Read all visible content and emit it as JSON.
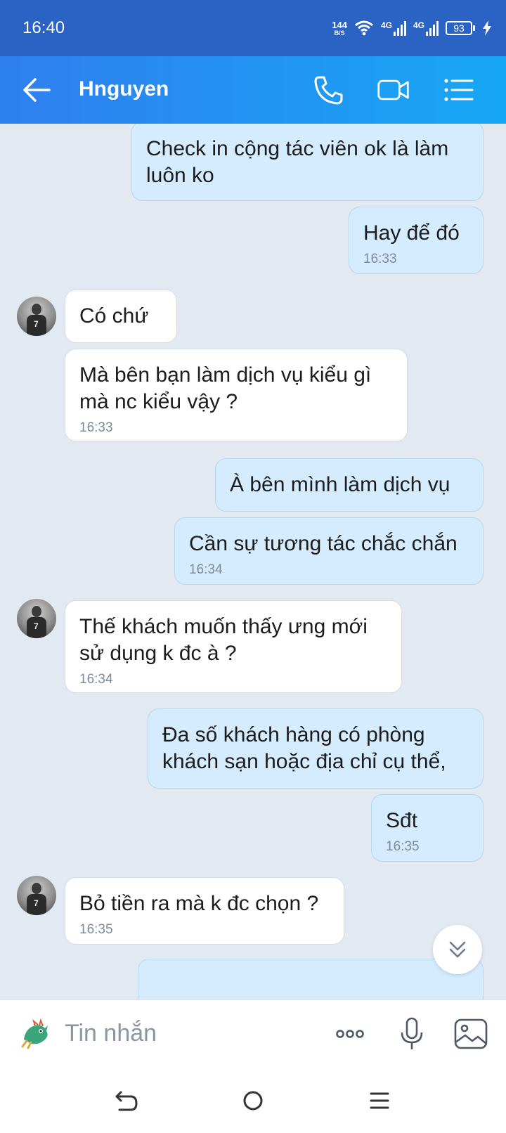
{
  "status_bar": {
    "time": "16:40",
    "net_speed_value": "144",
    "net_speed_unit": "B/S",
    "sim1_label": "4G",
    "sim2_label": "4G",
    "battery": "93"
  },
  "header": {
    "contact_name": "Hnguyen"
  },
  "messages": [
    {
      "sender": "me",
      "text": "Check in cộng tác viên ok là làm luôn ko",
      "time": ""
    },
    {
      "sender": "me",
      "text": "Hay để đó",
      "time": "16:33"
    },
    {
      "sender": "them",
      "text": "Có chứ",
      "time": ""
    },
    {
      "sender": "them",
      "text": "Mà bên bạn làm dịch vụ kiểu gì mà nc kiểu vậy ?",
      "time": "16:33"
    },
    {
      "sender": "me",
      "text": "À bên mình làm dịch vụ",
      "time": ""
    },
    {
      "sender": "me",
      "text": "Cần sự tương tác chắc chắn",
      "time": "16:34"
    },
    {
      "sender": "them",
      "text": "Thế khách muốn thấy ưng mới sử dụng k đc à ?",
      "time": "16:34"
    },
    {
      "sender": "me",
      "text": "Đa số khách hàng có phòng khách sạn hoặc địa chỉ cụ thể,",
      "time": ""
    },
    {
      "sender": "me",
      "text": "Sđt",
      "time": "16:35"
    },
    {
      "sender": "them",
      "text": "Bỏ tiền ra mà k đc chọn ?",
      "time": "16:35"
    }
  ],
  "input": {
    "placeholder": "Tin nhắn"
  },
  "colors": {
    "header_start": "#2f7ff0",
    "header_end": "#17a7f4",
    "status_bar": "#2a63c4",
    "chat_bg": "#e2e9f1",
    "my_bubble": "#d5ecfe",
    "their_bubble": "#ffffff"
  },
  "icons": {
    "back": "arrow-left-icon",
    "call": "phone-icon",
    "video": "video-camera-icon",
    "menu": "list-menu-icon",
    "scroll": "double-chevron-down-icon",
    "more": "more-dots-icon",
    "mic": "microphone-icon",
    "gallery": "image-icon",
    "nav_back": "nav-back-icon",
    "nav_home": "nav-home-icon",
    "nav_recents": "nav-recents-icon"
  }
}
